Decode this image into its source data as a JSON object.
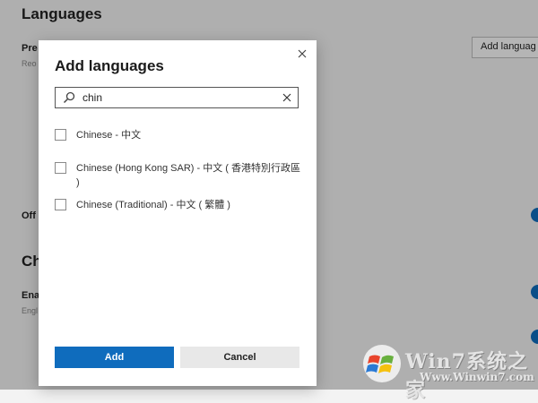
{
  "background": {
    "section_languages": "Languages",
    "preferred_label": "Pre",
    "preferred_desc": "Reo",
    "add_languages_button": "Add languag",
    "offer_label": "Off",
    "section_check": "Ch",
    "enable_label": "Ena",
    "english_desc": "Engl"
  },
  "dialog": {
    "title": "Add languages",
    "search": {
      "value": "chin",
      "icon": "search-icon"
    },
    "languages": [
      {
        "label": "Chinese - 中文",
        "checked": false
      },
      {
        "label": "Chinese (Hong Kong SAR) - 中文 ( 香港特別行政區 )",
        "checked": false
      },
      {
        "label": "Chinese (Traditional) - 中文 ( 繁體 )",
        "checked": false
      }
    ],
    "add_button": "Add",
    "cancel_button": "Cancel",
    "accent_color": "#0f6cbd"
  },
  "watermark": {
    "brand": "Win7系统之家",
    "url": "Www.Winwin7.com"
  }
}
